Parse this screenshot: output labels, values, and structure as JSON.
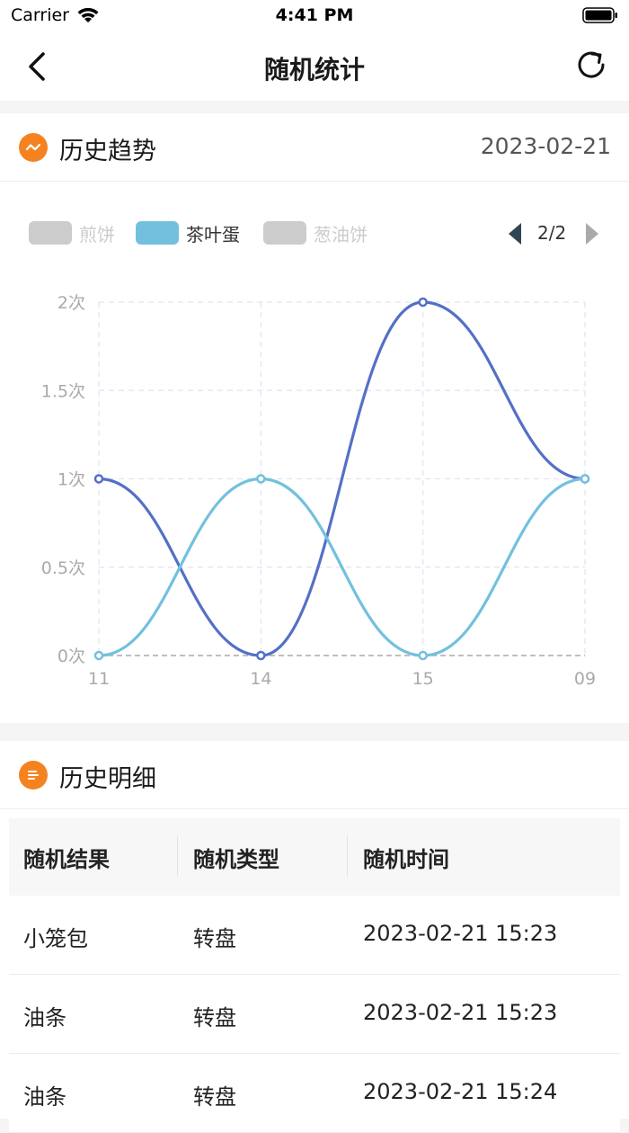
{
  "status_bar": {
    "carrier": "Carrier",
    "time": "4:41 PM"
  },
  "nav": {
    "title": "随机统计",
    "back_icon": "chevron-left-icon",
    "refresh_icon": "refresh-icon"
  },
  "trend": {
    "title": "历史趋势",
    "date": "2023-02-21",
    "icon": "trend-icon",
    "accent_color": "#f58220",
    "legend": [
      {
        "label": "煎饼",
        "active": false,
        "color": "#cccccc"
      },
      {
        "label": "茶叶蛋",
        "active": true,
        "color": "#73c0de"
      },
      {
        "label": "葱油饼",
        "active": false,
        "color": "#cccccc"
      }
    ],
    "pager": "2/2"
  },
  "chart_data": {
    "type": "line",
    "smooth": true,
    "categories": [
      "11",
      "14",
      "15",
      "09"
    ],
    "y_ticks": [
      "0次",
      "0.5次",
      "1次",
      "1.5次",
      "2次"
    ],
    "ylim": [
      0,
      2
    ],
    "grid": true,
    "series": [
      {
        "color": "#5470c6",
        "values": [
          1,
          0,
          2,
          1
        ]
      },
      {
        "name": "茶叶蛋",
        "color": "#73c0de",
        "values": [
          0,
          1,
          0,
          1
        ]
      }
    ]
  },
  "detail": {
    "title": "历史明细",
    "icon": "list-icon",
    "columns": [
      "随机结果",
      "随机类型",
      "随机时间"
    ],
    "rows": [
      {
        "result": "小笼包",
        "type": "转盘",
        "time": "2023-02-21 15:23"
      },
      {
        "result": "油条",
        "type": "转盘",
        "time": "2023-02-21 15:23"
      },
      {
        "result": "油条",
        "type": "转盘",
        "time": "2023-02-21 15:24"
      }
    ]
  }
}
